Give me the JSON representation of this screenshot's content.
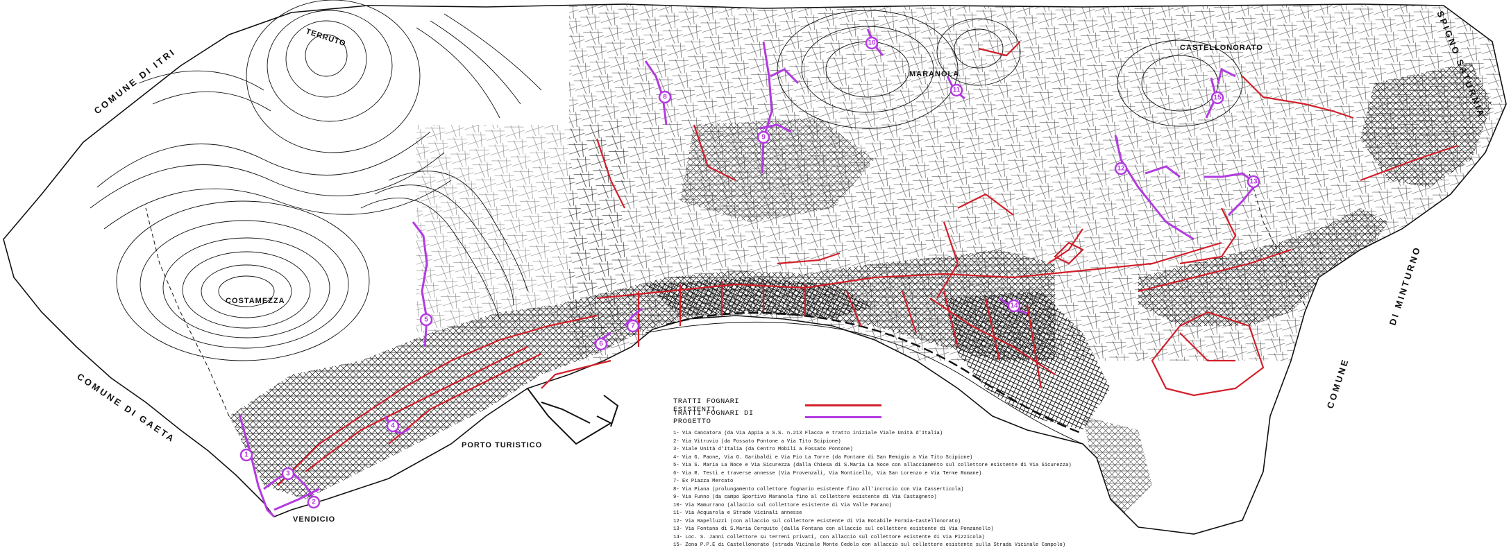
{
  "colors": {
    "existing": "#d21f2a",
    "project": "#b33be0",
    "base": "#111111",
    "sea": "#ffffff"
  },
  "places": {
    "comune_itri": "COMUNE DI ITRI",
    "spigno": "SPIGNO SATURNIA",
    "comune_gaeta": "COMUNE DI GAETA",
    "comune_minturno_a": "COMUNE",
    "comune_minturno_b": "DI MINTURNO",
    "costamezza": "COSTAMEZZA",
    "terruto": "TERRUTO",
    "porto_turistico": "PORTO TURISTICO",
    "vendicio": "VENDICIO",
    "castellonorato": "CASTELLONORATO",
    "maranola": "MARANOLA"
  },
  "legend": {
    "existing_label": "TRATTI FOGNARI ESISTENTI",
    "project_label": "TRATTI FOGNARI DI PROGETTO"
  },
  "notes": [
    "1- Via Cancatora (da Via Appia a S.S. n.213 Flacca e tratto iniziale Viale Unità d'Italia)",
    "2- Via Vitruvio (da Fossato Pontone a Via Tito Scipione)",
    "3- Viale Unità d'Italia (da Centro Mobili a Fossato Pontone)",
    "4- Via G. Paone, Via G. Garibaldi e Via Pio La Torre (da Fontane di San Remigio a Via Tito Scipione)",
    "5- Via S. Maria La Noce e Via Sicurezza (dalla Chiesa di S.Maria La Noce con allacciamento sul collettore esistente di Via Sicurezza)",
    "6- Via R. Testi e traverse annesse (Via Provenzali, Via Monticello, Via San Lorenzo e Via Terme Romane)",
    "7- Ex Piazza Mercato",
    "8- Via Piana (prolungamento collettore fognario esistente fino all'incrocio con Via Casserticola)",
    "9- Via Funno (da campo Sportivo Maranola fino al collettore esistente di Via Castagneto)",
    "10- Via Mamurrano (allaccio sul collettore esistente di Via Valle Farano)",
    "11- Via Acquarola e Strade Vicinali annesse",
    "12- Via Rapelluzzi (con allaccio sul collettore esistente di Via Rotabile Formia-Castellonorato)",
    "13- Via Fontana di S.Maria Cerquito (dalla Fontana con allaccio sul collettore esistente di Via Ponzanello)",
    "14- Loc. S. Janni collettore su terreni privati, con allaccio sul collettore esistente di Via Pizzicola)",
    "15- Zona P.P.E di Castellonorato (strada Vicinale Monte Cedolo con allaccio sul collettore esistente sulla Strada Vicinale Campolo)"
  ],
  "markers": [
    "1",
    "2",
    "3",
    "4",
    "5",
    "6",
    "7",
    "8",
    "9",
    "10",
    "11",
    "12",
    "13",
    "14",
    "15"
  ]
}
